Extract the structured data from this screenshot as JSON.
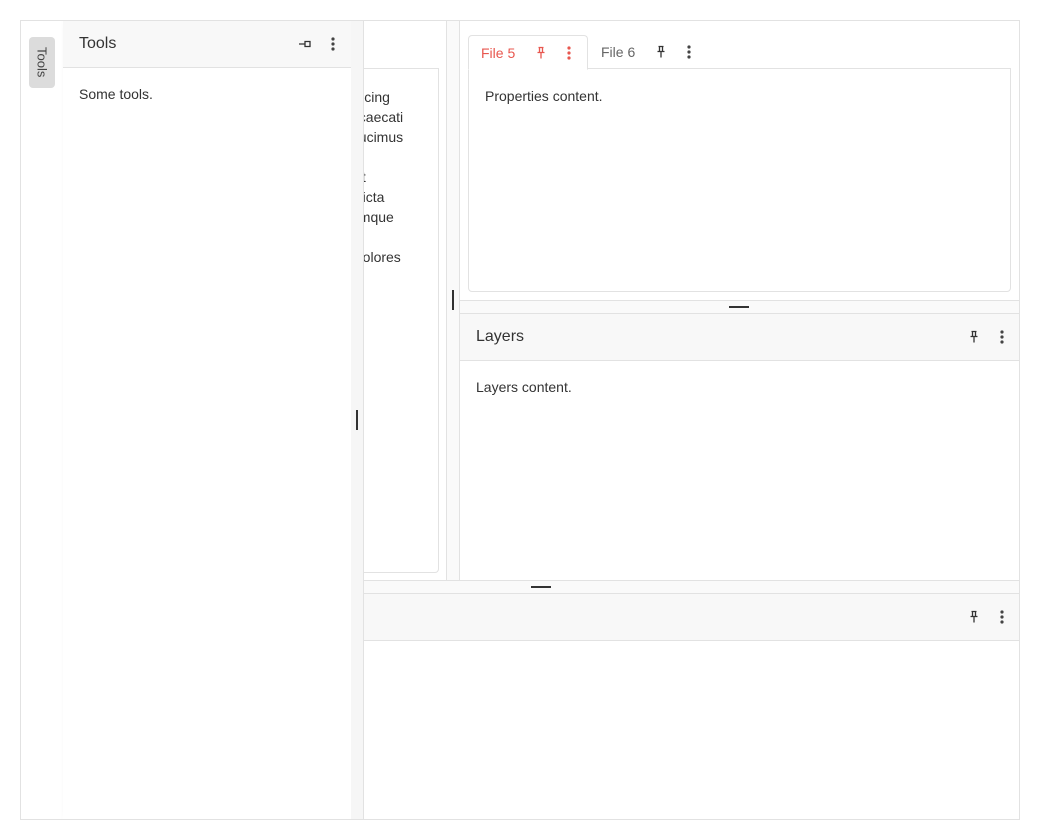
{
  "rail": {
    "tab_label": "Tools"
  },
  "tools_panel": {
    "title": "Tools",
    "content": "Some tools."
  },
  "editor": {
    "lines": [
      "isicing",
      "ocaecati",
      "ducimus",
      "",
      "git",
      " dicta",
      "emque",
      "",
      " dolores"
    ]
  },
  "tabs": [
    {
      "label": "File 5",
      "active": true
    },
    {
      "label": "File 6",
      "active": false
    }
  ],
  "properties": {
    "content": "Properties content."
  },
  "layers": {
    "title": "Layers",
    "content": "Layers content."
  },
  "bottom_panel": {
    "title": ""
  },
  "colors": {
    "accent": "#e8574f",
    "border": "#e2e2e2",
    "header_bg": "#f8f8f8"
  }
}
